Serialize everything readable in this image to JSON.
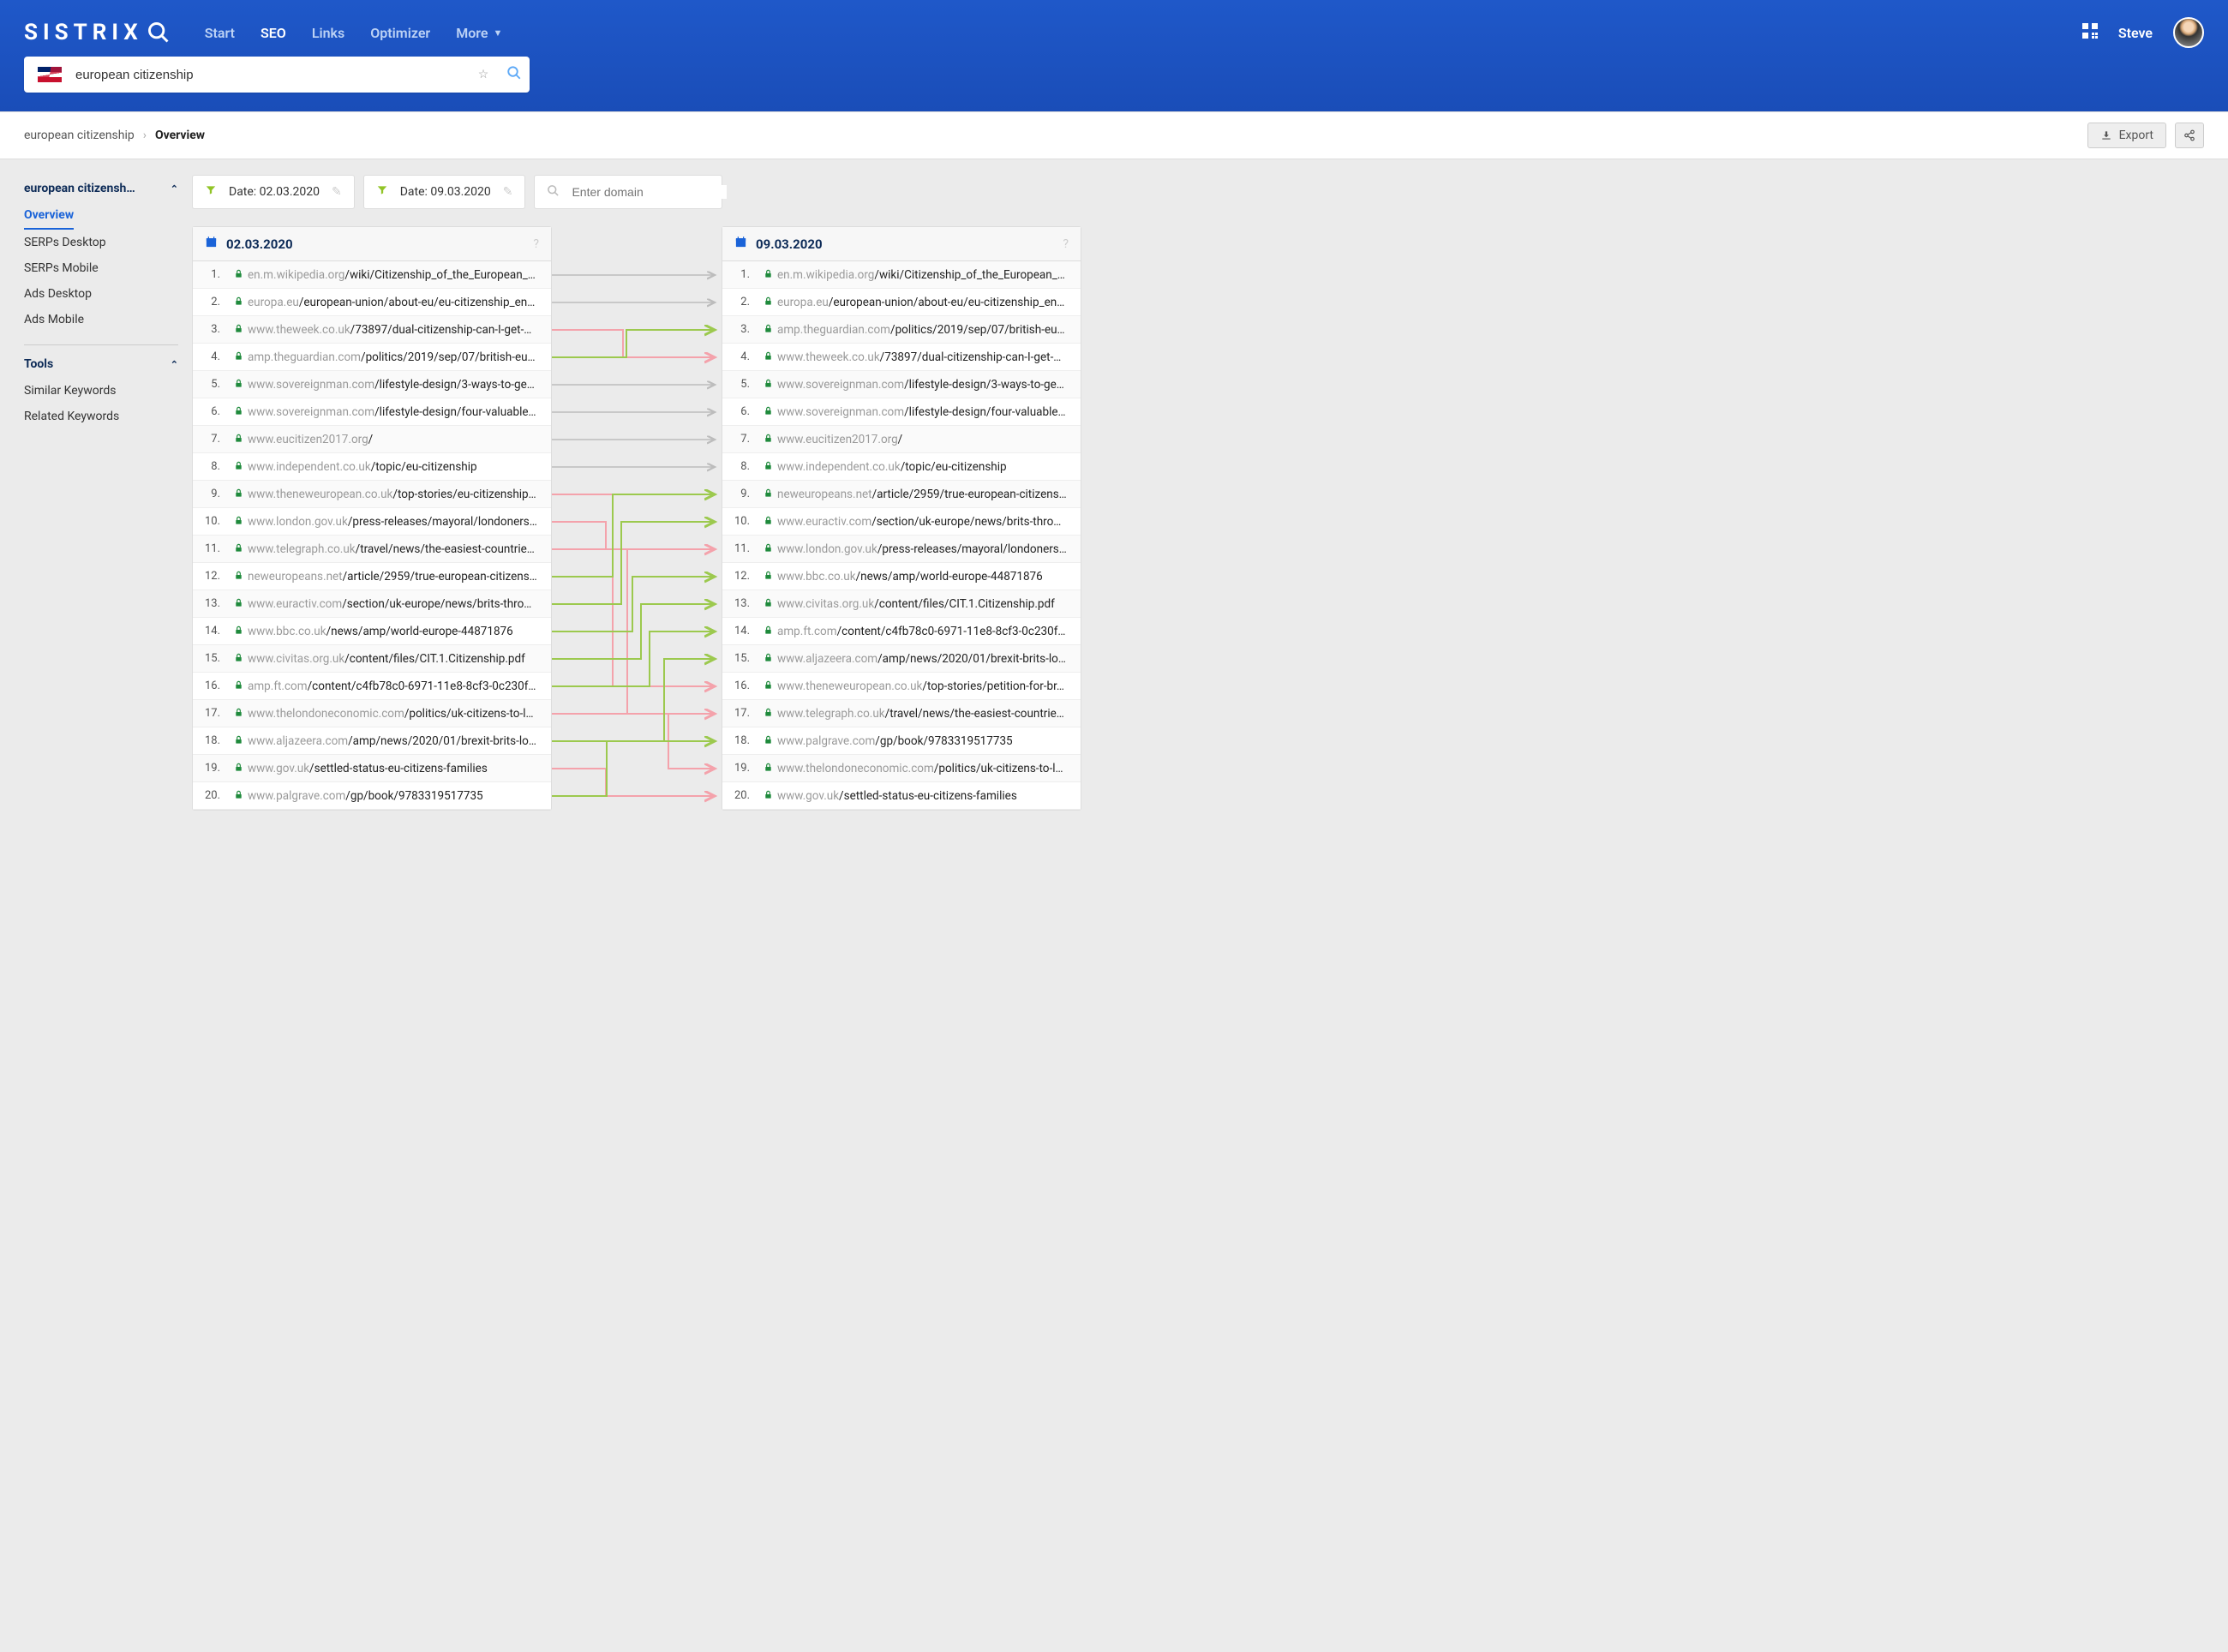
{
  "nav": {
    "logo_text": "SISTRIX",
    "links": [
      "Start",
      "SEO",
      "Links",
      "Optimizer",
      "More"
    ],
    "active_link": "SEO",
    "username": "Steve"
  },
  "search": {
    "value": "european citizenship"
  },
  "breadcrumb": {
    "items": [
      "european citizenship",
      "Overview"
    ]
  },
  "actions": {
    "export": "Export"
  },
  "sidebar": {
    "section1_title": "european citizensh…",
    "section1_links": [
      "Overview",
      "SERPs Desktop",
      "SERPs Mobile",
      "Ads Desktop",
      "Ads Mobile"
    ],
    "active_link": "Overview",
    "section2_title": "Tools",
    "section2_links": [
      "Similar Keywords",
      "Related Keywords"
    ]
  },
  "filters": {
    "date1": "Date: 02.03.2020",
    "date2": "Date: 09.03.2020",
    "domain_placeholder": "Enter domain"
  },
  "panel1": {
    "date": "02.03.2020",
    "rows": [
      {
        "host": "en.m.wikipedia.org",
        "path": "/wiki/Citizenship_of_the_European_…"
      },
      {
        "host": "europa.eu",
        "path": "/european-union/about-eu/eu-citizenship_en…"
      },
      {
        "host": "www.theweek.co.uk",
        "path": "/73897/dual-citizenship-can-I-get-…"
      },
      {
        "host": "amp.theguardian.com",
        "path": "/politics/2019/sep/07/british-eu…"
      },
      {
        "host": "www.sovereignman.com",
        "path": "/lifestyle-design/3-ways-to-ge…"
      },
      {
        "host": "www.sovereignman.com",
        "path": "/lifestyle-design/four-valuable…"
      },
      {
        "host": "www.eucitizen2017.org",
        "path": "/"
      },
      {
        "host": "www.independent.co.uk",
        "path": "/topic/eu-citizenship"
      },
      {
        "host": "www.theneweuropean.co.uk",
        "path": "/top-stories/eu-citizenship…"
      },
      {
        "host": "www.london.gov.uk",
        "path": "/press-releases/mayoral/londoners…"
      },
      {
        "host": "www.telegraph.co.uk",
        "path": "/travel/news/the-easiest-countrie…"
      },
      {
        "host": "neweuropeans.net",
        "path": "/article/2959/true-european-citizens…"
      },
      {
        "host": "www.euractiv.com",
        "path": "/section/uk-europe/news/brits-thro…"
      },
      {
        "host": "www.bbc.co.uk",
        "path": "/news/amp/world-europe-44871876"
      },
      {
        "host": "www.civitas.org.uk",
        "path": "/content/files/CIT.1.Citizenship.pdf"
      },
      {
        "host": "amp.ft.com",
        "path": "/content/c4fb78c0-6971-11e8-8cf3-0c230f…"
      },
      {
        "host": "www.thelondoneconomic.com",
        "path": "/politics/uk-citizens-to-l…"
      },
      {
        "host": "www.aljazeera.com",
        "path": "/amp/news/2020/01/brexit-brits-lo…"
      },
      {
        "host": "www.gov.uk",
        "path": "/settled-status-eu-citizens-families"
      },
      {
        "host": "www.palgrave.com",
        "path": "/gp/book/9783319517735"
      }
    ]
  },
  "panel2": {
    "date": "09.03.2020",
    "rows": [
      {
        "host": "en.m.wikipedia.org",
        "path": "/wiki/Citizenship_of_the_European_…"
      },
      {
        "host": "europa.eu",
        "path": "/european-union/about-eu/eu-citizenship_en…"
      },
      {
        "host": "amp.theguardian.com",
        "path": "/politics/2019/sep/07/british-eu…"
      },
      {
        "host": "www.theweek.co.uk",
        "path": "/73897/dual-citizenship-can-I-get-…"
      },
      {
        "host": "www.sovereignman.com",
        "path": "/lifestyle-design/3-ways-to-ge…"
      },
      {
        "host": "www.sovereignman.com",
        "path": "/lifestyle-design/four-valuable…"
      },
      {
        "host": "www.eucitizen2017.org",
        "path": "/"
      },
      {
        "host": "www.independent.co.uk",
        "path": "/topic/eu-citizenship"
      },
      {
        "host": "neweuropeans.net",
        "path": "/article/2959/true-european-citizens…"
      },
      {
        "host": "www.euractiv.com",
        "path": "/section/uk-europe/news/brits-thro…"
      },
      {
        "host": "www.london.gov.uk",
        "path": "/press-releases/mayoral/londoners…"
      },
      {
        "host": "www.bbc.co.uk",
        "path": "/news/amp/world-europe-44871876"
      },
      {
        "host": "www.civitas.org.uk",
        "path": "/content/files/CIT.1.Citizenship.pdf"
      },
      {
        "host": "amp.ft.com",
        "path": "/content/c4fb78c0-6971-11e8-8cf3-0c230f…"
      },
      {
        "host": "www.aljazeera.com",
        "path": "/amp/news/2020/01/brexit-brits-lo…"
      },
      {
        "host": "www.theneweuropean.co.uk",
        "path": "/top-stories/petition-for-br…"
      },
      {
        "host": "www.telegraph.co.uk",
        "path": "/travel/news/the-easiest-countrie…"
      },
      {
        "host": "www.palgrave.com",
        "path": "/gp/book/9783319517735"
      },
      {
        "host": "www.thelondoneconomic.com",
        "path": "/politics/uk-citizens-to-l…"
      },
      {
        "host": "www.gov.uk",
        "path": "/settled-status-eu-citizens-families"
      }
    ]
  },
  "connectors": [
    {
      "from": 1,
      "to": 1,
      "color": "gray"
    },
    {
      "from": 2,
      "to": 2,
      "color": "gray"
    },
    {
      "from": 3,
      "to": 4,
      "color": "red"
    },
    {
      "from": 4,
      "to": 3,
      "color": "green"
    },
    {
      "from": 5,
      "to": 5,
      "color": "gray"
    },
    {
      "from": 6,
      "to": 6,
      "color": "gray"
    },
    {
      "from": 7,
      "to": 7,
      "color": "gray"
    },
    {
      "from": 8,
      "to": 8,
      "color": "gray"
    },
    {
      "from": 9,
      "to": 16,
      "color": "red"
    },
    {
      "from": 10,
      "to": 11,
      "color": "red"
    },
    {
      "from": 11,
      "to": 17,
      "color": "red"
    },
    {
      "from": 12,
      "to": 9,
      "color": "green"
    },
    {
      "from": 13,
      "to": 10,
      "color": "green"
    },
    {
      "from": 14,
      "to": 12,
      "color": "green"
    },
    {
      "from": 15,
      "to": 13,
      "color": "green"
    },
    {
      "from": 16,
      "to": 14,
      "color": "green"
    },
    {
      "from": 17,
      "to": 19,
      "color": "red"
    },
    {
      "from": 18,
      "to": 15,
      "color": "green"
    },
    {
      "from": 19,
      "to": 20,
      "color": "red"
    },
    {
      "from": 20,
      "to": 18,
      "color": "green"
    }
  ]
}
